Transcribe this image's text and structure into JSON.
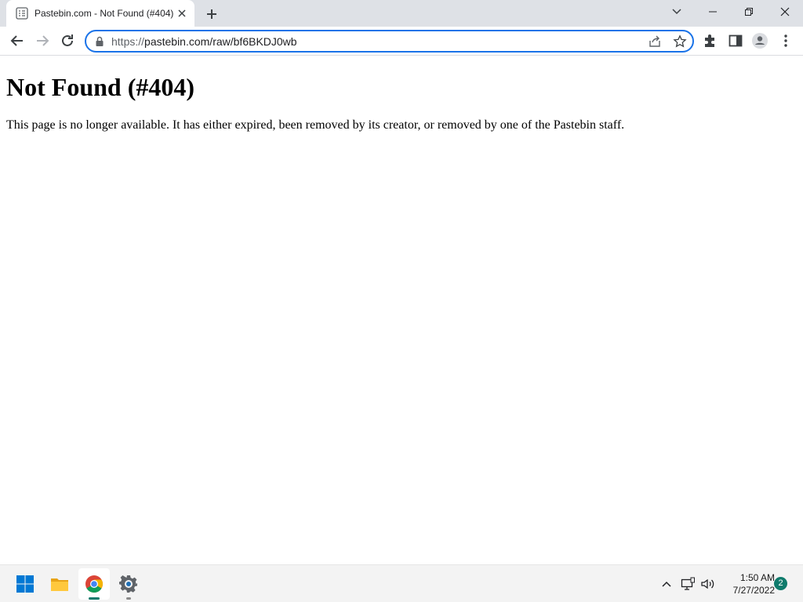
{
  "browser": {
    "tab": {
      "title": "Pastebin.com - Not Found (#404)"
    },
    "address_bar": {
      "scheme": "https://",
      "url_rest": "pastebin.com/raw/bf6BKDJ0wb"
    }
  },
  "page": {
    "heading": "Not Found (#404)",
    "message": "This page is no longer available. It has either expired, been removed by its creator, or removed by one of the Pastebin staff."
  },
  "taskbar": {
    "time": "1:50 AM",
    "date": "7/27/2022",
    "notification_count": "2",
    "apps": [
      "start-icon",
      "file-explorer-icon",
      "chrome-icon",
      "settings-icon"
    ]
  },
  "colors": {
    "accent": "#1a73e8",
    "tab_strip": "#dee1e6",
    "taskbar": "#f3f3f3",
    "badge": "#0f7b6c"
  }
}
